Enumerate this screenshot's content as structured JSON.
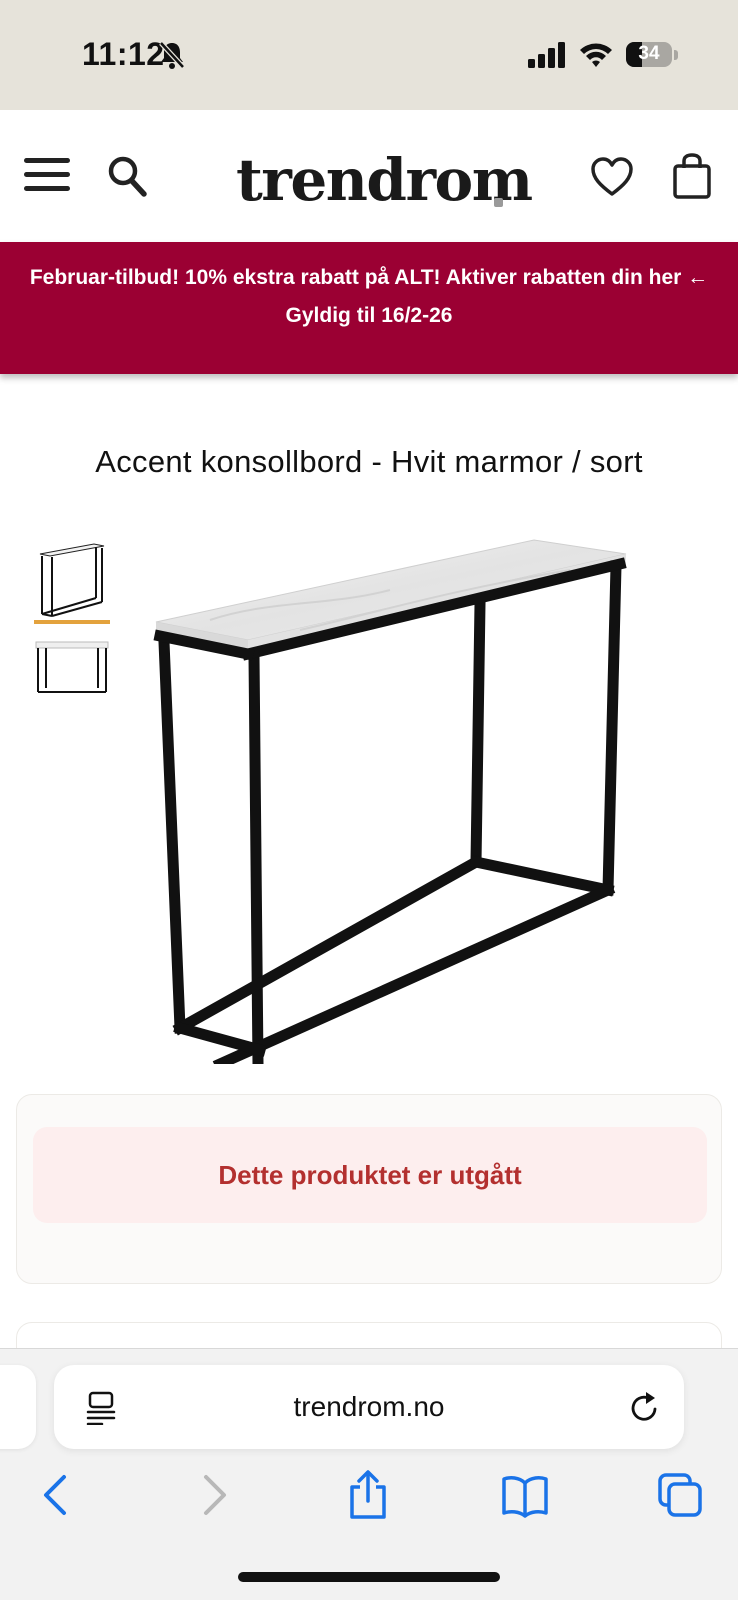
{
  "status_bar": {
    "time": "11:12",
    "battery_level": "34",
    "battery_fraction": 0.34,
    "icons": [
      "bell-slash-icon",
      "cellular-signal-icon",
      "wifi-icon",
      "battery-icon"
    ]
  },
  "header": {
    "logo": "trendrom",
    "icons": [
      "menu-icon",
      "search-icon",
      "heart-icon",
      "shopping-bag-icon"
    ]
  },
  "promo": {
    "line1": "Februar-tilbud! 10% ekstra rabatt på ALT! Aktiver rabatten din her ←",
    "line2": "Gyldig til 16/2-26",
    "background": "#9b0033"
  },
  "product": {
    "title": "Accent konsollbord - Hvit marmor / sort",
    "thumbnails_count": 2,
    "selected_thumbnail": 1,
    "selected_color": "#e3a23d"
  },
  "availability": {
    "message": "Dette produktet er utgått",
    "text_color": "#b3302f",
    "background": "#fdeeee"
  },
  "browser": {
    "url": "trendrom.no",
    "toolbar_icons": [
      "back-icon",
      "forward-icon",
      "share-icon",
      "bookmarks-icon",
      "tabs-icon"
    ],
    "accent": "#1a73e8"
  }
}
